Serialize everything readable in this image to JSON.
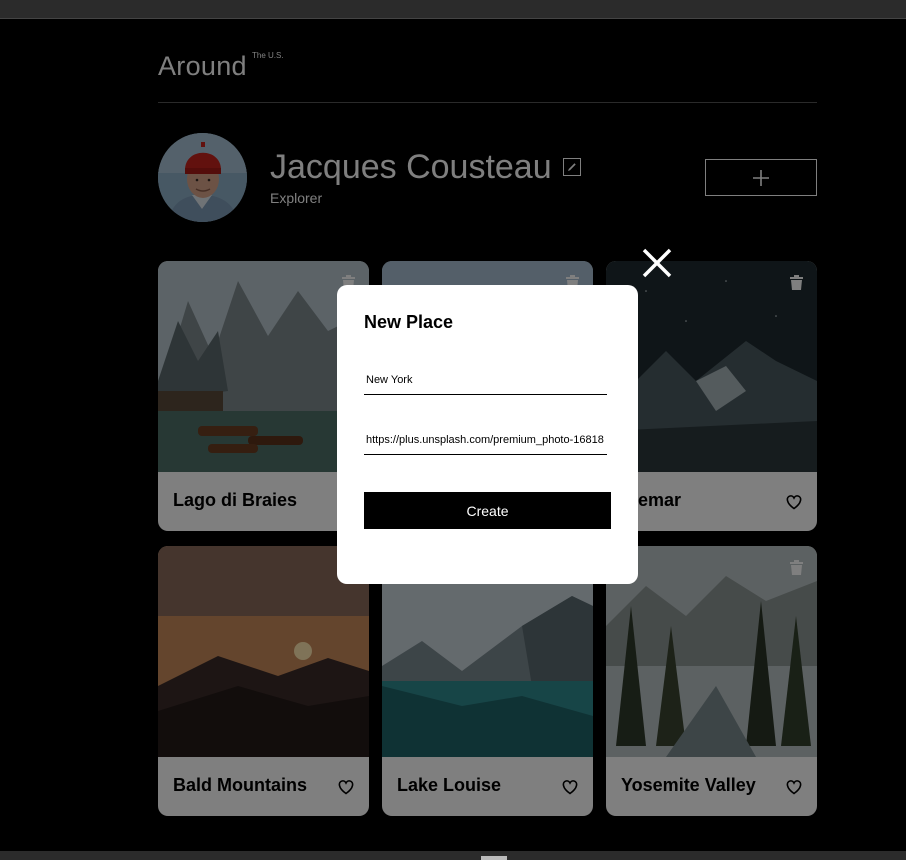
{
  "header": {
    "logo": "Around",
    "logo_sup": "The U.S."
  },
  "profile": {
    "name": "Jacques Cousteau",
    "job": "Explorer"
  },
  "cards": [
    {
      "title": "Lago di Braies"
    },
    {
      "title": ""
    },
    {
      "title": "ntemar"
    },
    {
      "title": "Bald Mountains"
    },
    {
      "title": "Lake Louise"
    },
    {
      "title": "Yosemite Valley"
    }
  ],
  "modal": {
    "title": "New Place",
    "name_value": "New York",
    "link_value": "https://plus.unsplash.com/premium_photo-16818",
    "submit_label": "Create"
  },
  "colors": {
    "page_background": "#000000",
    "card_background": "#ffffff",
    "overlay": "rgba(0,0,0,0.5)",
    "button_black": "#000000"
  }
}
